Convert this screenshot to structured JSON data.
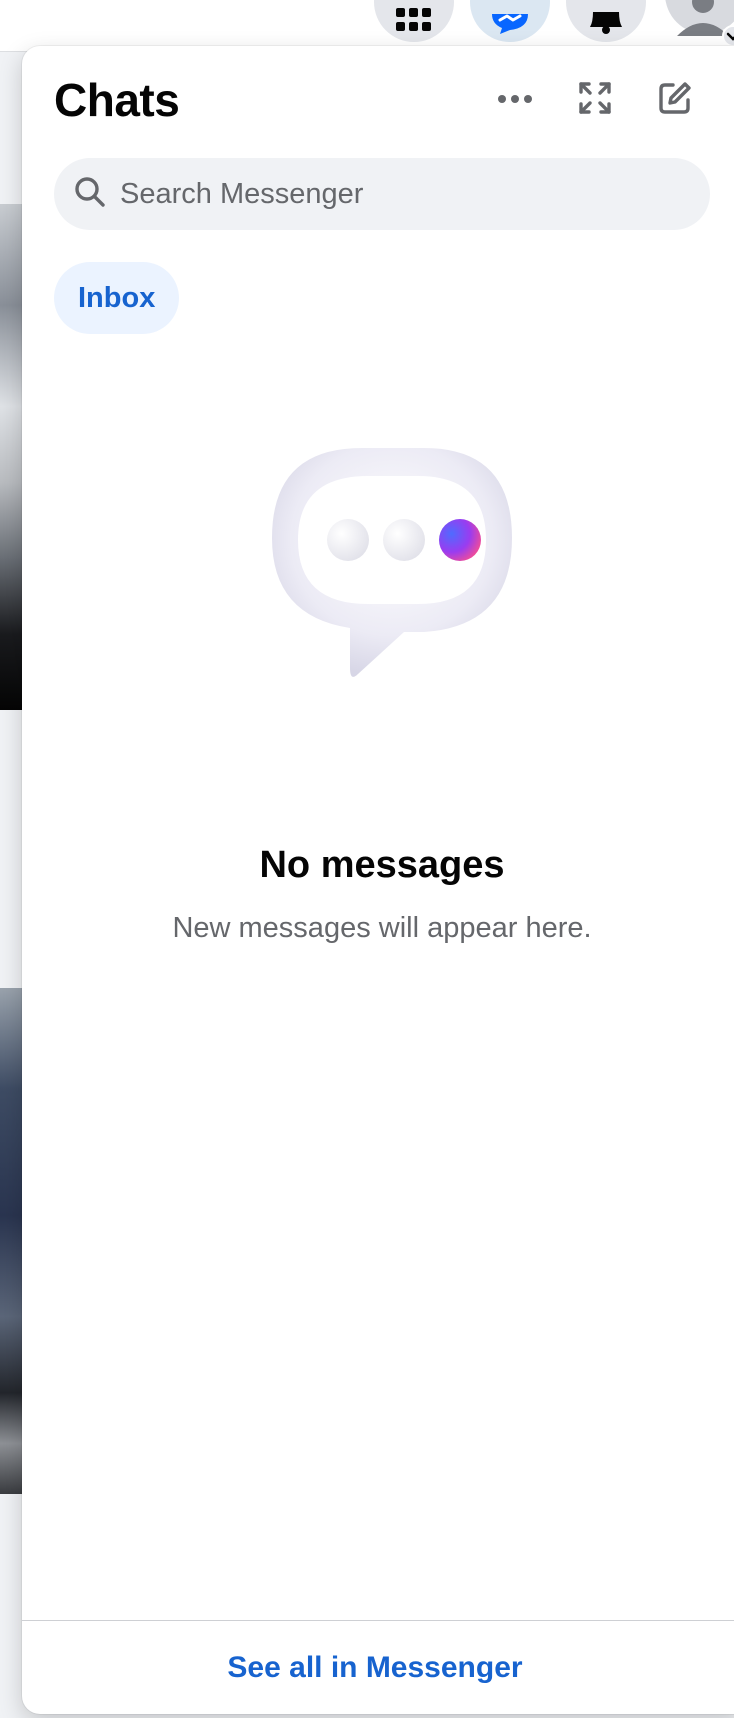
{
  "panel": {
    "title": "Chats",
    "search_placeholder": "Search Messenger",
    "filter_chip": "Inbox",
    "empty_state": {
      "title": "No messages",
      "subtitle": "New messages will appear here."
    },
    "footer_link": "See all in Messenger"
  },
  "top_nav": {
    "icons": [
      "menu-grid-icon",
      "messenger-icon",
      "notifications-bell-icon",
      "account-avatar-icon"
    ]
  },
  "header_icons": [
    "more-options-icon",
    "expand-icon",
    "new-message-icon"
  ],
  "colors": {
    "accent": "#1763cf",
    "chip_bg": "#ebf3ff",
    "search_bg": "#f0f2f5",
    "messenger_blue": "#0866ff"
  }
}
